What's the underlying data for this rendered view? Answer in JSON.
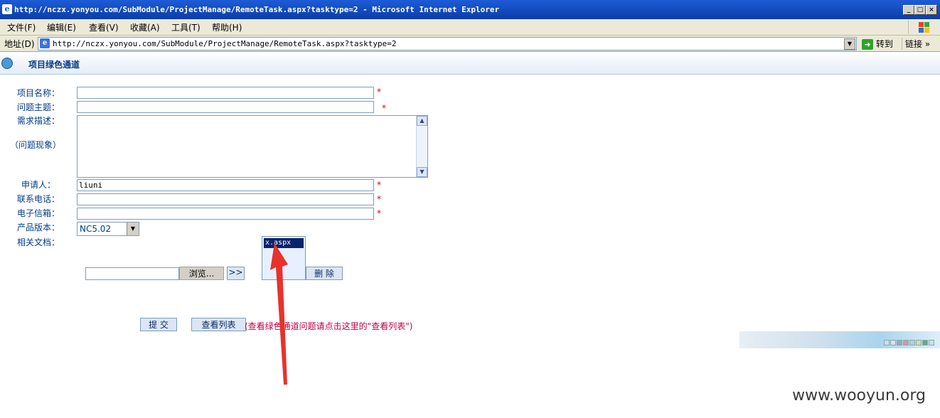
{
  "window": {
    "title": "http://nczx.yonyou.com/SubModule/ProjectManage/RemoteTask.aspx?tasktype=2 - Microsoft Internet Explorer",
    "controls": [
      "_",
      "□",
      "×"
    ]
  },
  "menu": [
    "文件(F)",
    "编辑(E)",
    "查看(V)",
    "收藏(A)",
    "工具(T)",
    "帮助(H)"
  ],
  "address": {
    "label": "地址(D)",
    "url": "http://nczx.yonyou.com/SubModule/ProjectManage/RemoteTask.aspx?tasktype=2",
    "go": "转到",
    "links": "链接"
  },
  "page": {
    "title": "项目绿色通道"
  },
  "form": {
    "project_name_label": "项目名称：",
    "subject_label": "问题主题：",
    "desc_label": "需求描述：",
    "desc_sub_label": "（问题现象）",
    "applicant_label": "申请人：",
    "applicant_value": "liuni",
    "phone_label": "联系电话：",
    "email_label": "电子信箱：",
    "version_label": "产品版本：",
    "version_value": "NC5.02",
    "docs_label": "相关文档：",
    "required_mark": "*"
  },
  "upload": {
    "browse": "浏览...",
    "add": ">>",
    "file_item": "x.aspx",
    "delete": "删 除"
  },
  "actions": {
    "submit": "提 交",
    "view_list": "查看列表",
    "notice": "(查看绿色通道问题请点击这里的\"查看列表\")"
  },
  "watermark": "www.wooyun.org",
  "colors": {
    "label": "#003c8a",
    "required": "#e00000",
    "notice": "#c00040",
    "arrow": "#e8322a",
    "titlebar": "#0a3ea8"
  }
}
